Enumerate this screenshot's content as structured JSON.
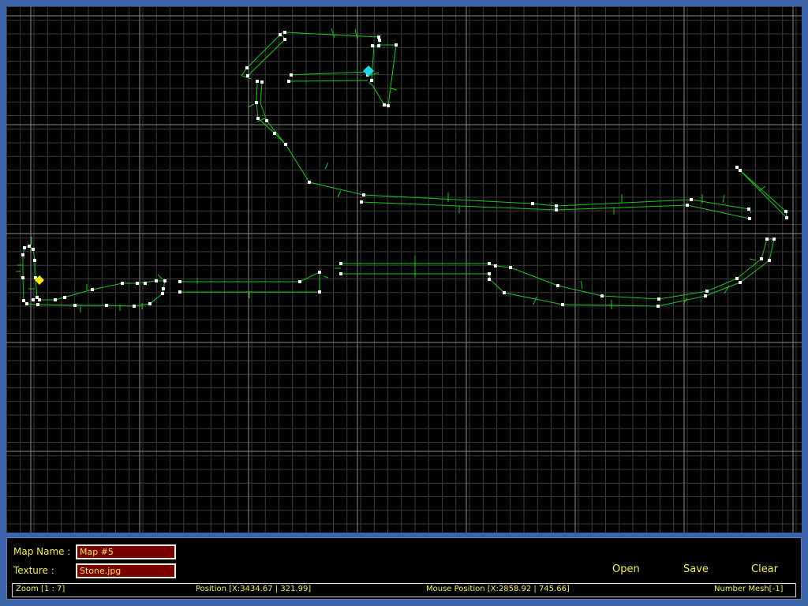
{
  "editor": {
    "colors": {
      "background": "#3a64a8",
      "grid_minor": "#3a3a3a",
      "grid_major": "#8c8c8c",
      "path_line": "#19c819",
      "normal_tick": "#19c819",
      "vertex": "#ffffff",
      "start_marker": "#f5e612",
      "end_marker": "#22d6e8",
      "text": "#f2ef5a",
      "field_bg": "#7a0000"
    },
    "markers": {
      "start_icon": "yellow-diamond",
      "end_icon": "cyan-diamond"
    }
  },
  "panel": {
    "map_name_label": "Map Name :",
    "map_name_value": "Map #5",
    "texture_label": "Texture :",
    "texture_value": "Stone.jpg",
    "open_label": "Open",
    "save_label": "Save",
    "clear_label": "Clear"
  },
  "status": {
    "zoom": "Zoom [1 : 7]",
    "position": "Position [X:3434.67 | 321.99]",
    "mouse_position": "Mouse Position [X:2858.92 | 745.66]",
    "number_mesh": "Number Mesh[-1]"
  }
}
